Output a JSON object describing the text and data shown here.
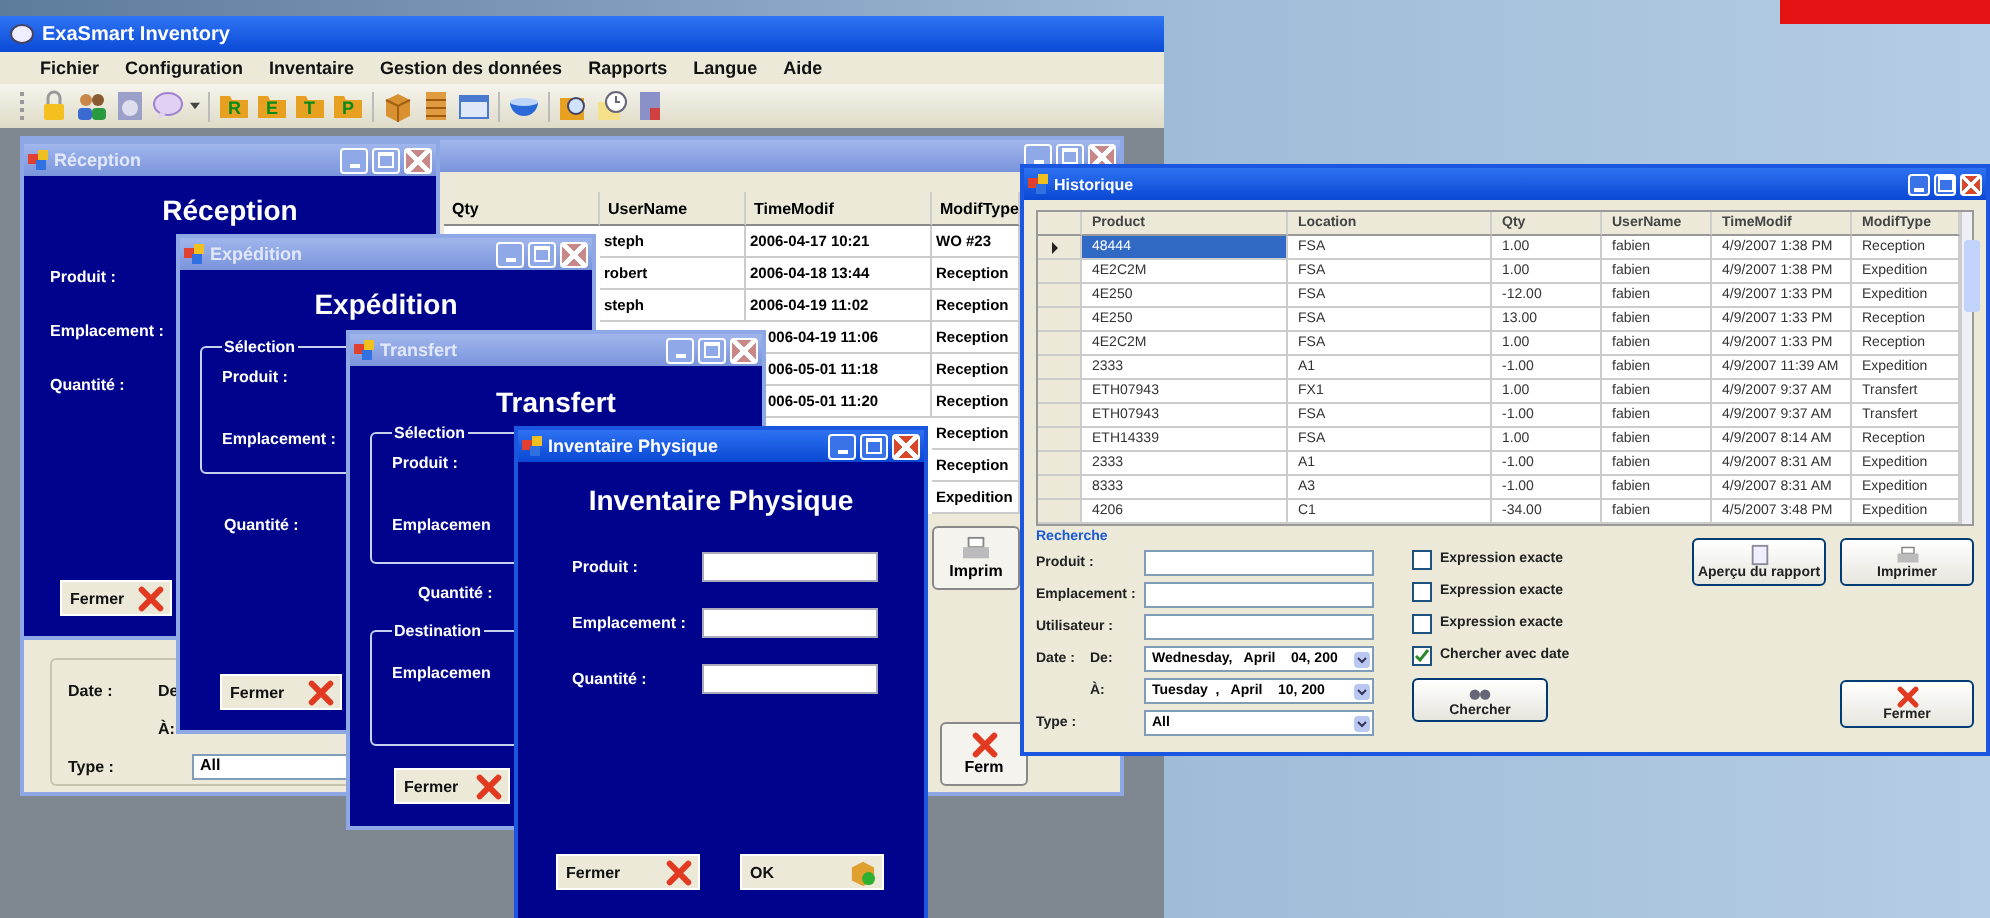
{
  "app": {
    "title": "ExaSmart Inventory",
    "menu": [
      "Fichier",
      "Configuration",
      "Inventaire",
      "Gestion des données",
      "Rapports",
      "Langue",
      "Aide"
    ],
    "toolbar_letters": [
      "R",
      "E",
      "T",
      "P"
    ]
  },
  "movements_window": {
    "active": false,
    "columns": [
      "Qty",
      "UserName",
      "TimeModif",
      "ModifType"
    ],
    "rows": [
      {
        "user_name": "steph",
        "time_modif": "2006-04-17 10:21",
        "modif_type": "WO #23"
      },
      {
        "user_name": "robert",
        "time_modif": "2006-04-18 13:44",
        "modif_type": "Reception"
      },
      {
        "user_name": "steph",
        "time_modif": "2006-04-19 11:02",
        "modif_type": "Reception"
      },
      {
        "time_modif": "006-04-19 11:06",
        "modif_type": "Reception"
      },
      {
        "time_modif": "006-05-01 11:18",
        "modif_type": "Reception"
      },
      {
        "time_modif": "006-05-01 11:20",
        "modif_type": "Reception"
      },
      {
        "modif_type": "Reception"
      },
      {
        "modif_type": "Reception"
      },
      {
        "modif_type": "Expedition"
      }
    ],
    "date_label": "Date :",
    "from_label": "De",
    "to_label": "À:",
    "type_label": "Type :",
    "type_value": "All",
    "print_button": "Imprim",
    "close_button": "Ferm"
  },
  "reception_window": {
    "active": false,
    "title": "Réception",
    "heading": "Réception",
    "labels": [
      "Produit :",
      "Emplacement :",
      "Quantité :"
    ],
    "close_button": "Fermer"
  },
  "expedition_window": {
    "active": false,
    "title": "Expédition",
    "heading": "Expédition",
    "selection_group": "Sélection",
    "selection_labels": [
      "Produit :",
      "Emplacement :"
    ],
    "quantity_label": "Quantité :",
    "close_button": "Fermer"
  },
  "transfer_window": {
    "active": false,
    "title": "Transfert",
    "heading": "Transfert",
    "selection_group": "Sélection",
    "selection_labels": [
      "Produit :",
      "Emplacemen"
    ],
    "quantity_label": "Quantité :",
    "destination_group": "Destination",
    "destination_labels": [
      "Emplacemen"
    ],
    "close_button": "Fermer"
  },
  "physical_count_window": {
    "active": true,
    "title": "Inventaire Physique",
    "heading": "Inventaire Physique",
    "fields": [
      {
        "label": "Produit :"
      },
      {
        "label": "Emplacement :"
      },
      {
        "label": "Quantité :"
      }
    ],
    "buttons": [
      {
        "kind": "close",
        "label": "Fermer"
      },
      {
        "kind": "ok",
        "label": "OK"
      }
    ]
  },
  "history_window": {
    "active": true,
    "title": "Historique",
    "columns": [
      "Product",
      "Location",
      "Qty",
      "UserName",
      "TimeModif",
      "ModifType"
    ],
    "rows": [
      {
        "selected": true,
        "cells": [
          "48444",
          "FSA",
          "1.00",
          "fabien",
          "4/9/2007 1:38 PM",
          "Reception"
        ]
      },
      {
        "selected": false,
        "cells": [
          "4E2C2M",
          "FSA",
          "1.00",
          "fabien",
          "4/9/2007 1:38 PM",
          "Expedition"
        ]
      },
      {
        "selected": false,
        "cells": [
          "4E250",
          "FSA",
          "-12.00",
          "fabien",
          "4/9/2007 1:33 PM",
          "Expedition"
        ]
      },
      {
        "selected": false,
        "cells": [
          "4E250",
          "FSA",
          "13.00",
          "fabien",
          "4/9/2007 1:33 PM",
          "Reception"
        ]
      },
      {
        "selected": false,
        "cells": [
          "4E2C2M",
          "FSA",
          "1.00",
          "fabien",
          "4/9/2007 1:33 PM",
          "Reception"
        ]
      },
      {
        "selected": false,
        "cells": [
          "2333",
          "A1",
          "-1.00",
          "fabien",
          "4/9/2007 11:39 AM",
          "Expedition"
        ]
      },
      {
        "selected": false,
        "cells": [
          "ETH07943",
          "FX1",
          "1.00",
          "fabien",
          "4/9/2007 9:37 AM",
          "Transfert"
        ]
      },
      {
        "selected": false,
        "cells": [
          "ETH07943",
          "FSA",
          "-1.00",
          "fabien",
          "4/9/2007 9:37 AM",
          "Transfert"
        ]
      },
      {
        "selected": false,
        "cells": [
          "ETH14339",
          "FSA",
          "1.00",
          "fabien",
          "4/9/2007 8:14 AM",
          "Reception"
        ]
      },
      {
        "selected": false,
        "cells": [
          "2333",
          "A1",
          "-1.00",
          "fabien",
          "4/9/2007 8:31 AM",
          "Expedition"
        ]
      },
      {
        "selected": false,
        "cells": [
          "8333",
          "A3",
          "-1.00",
          "fabien",
          "4/9/2007 8:31 AM",
          "Expedition"
        ]
      },
      {
        "selected": false,
        "cells": [
          "4206",
          "C1",
          "-34.00",
          "fabien",
          "4/5/2007 3:48 PM",
          "Expedition"
        ]
      }
    ],
    "search_group": "Recherche",
    "fields": [
      {
        "label": "Produit :",
        "exact_label": "Expression exacte",
        "exact_checked": false
      },
      {
        "label": "Emplacement :",
        "exact_label": "Expression exacte",
        "exact_checked": false
      },
      {
        "label": "Utilisateur :",
        "exact_label": "Expression exacte",
        "exact_checked": false
      }
    ],
    "date_label": "Date :",
    "from_label": "De:",
    "from_value": "Wednesday,   April    04, 200",
    "to_label": "À:",
    "to_value": "Tuesday  ,   April    10, 200",
    "date_search": {
      "label": "Chercher avec date",
      "checked": true
    },
    "type_label": "Type :",
    "type_value": "All",
    "search_button": "Chercher",
    "preview_button": "Aperçu du rapport",
    "print_button": "Imprimer",
    "close_button": "Fermer"
  }
}
